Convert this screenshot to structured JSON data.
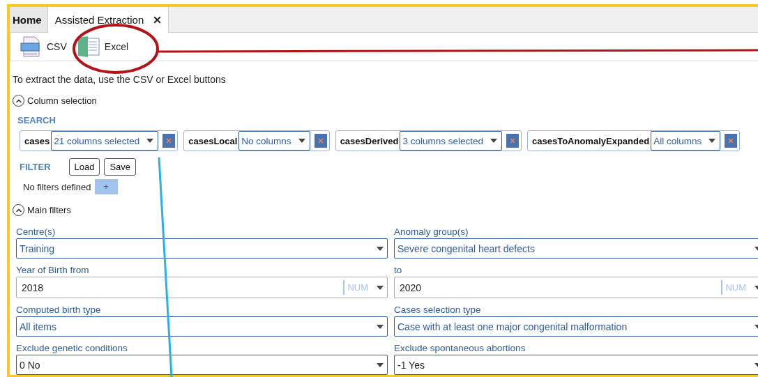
{
  "tabs": [
    {
      "label": "Home",
      "selected": false,
      "closable": false
    },
    {
      "label": "Assisted Extraction",
      "selected": true,
      "closable": true
    }
  ],
  "toolbar": [
    {
      "label": "CSV",
      "kind": "csv"
    },
    {
      "label": "Excel",
      "kind": "excel"
    }
  ],
  "instruction": "To extract the data, use the CSV or Excel buttons",
  "column_selection": {
    "title": "Column selection",
    "expanded": true,
    "search_heading": "SEARCH",
    "tables": [
      {
        "name": "cases",
        "value": "21 columns selected"
      },
      {
        "name": "casesLocal",
        "value": "No columns"
      },
      {
        "name": "casesDerived",
        "value": "3 columns selected"
      },
      {
        "name": "casesToAnomalyExpanded",
        "value": "All columns"
      }
    ]
  },
  "filter": {
    "heading": "FILTER",
    "buttons": [
      "Load",
      "Save"
    ],
    "empty_text": "No filters defined",
    "add": "+"
  },
  "main_filters": {
    "title": "Main filters",
    "expanded": true,
    "fields": [
      {
        "label": "Centre(s)",
        "value": "Training",
        "kind": "select"
      },
      {
        "label": "Anomaly group(s)",
        "value": "Severe congenital heart defects",
        "kind": "select"
      },
      {
        "label": "Year of Birth from",
        "value": "2018",
        "kind": "number",
        "unit": "NUM"
      },
      {
        "label": "to",
        "value": "2020",
        "kind": "number",
        "unit": "NUM"
      },
      {
        "label": "Computed birth type",
        "value": "All items",
        "kind": "select"
      },
      {
        "label": "Cases selection type",
        "value": "Case with at least one major congenital malformation",
        "kind": "select"
      },
      {
        "label": "Exclude genetic conditions",
        "value": "0 No",
        "kind": "coded"
      },
      {
        "label": "Exclude spontaneous abortions",
        "value": "-1 Yes",
        "kind": "coded"
      }
    ]
  }
}
